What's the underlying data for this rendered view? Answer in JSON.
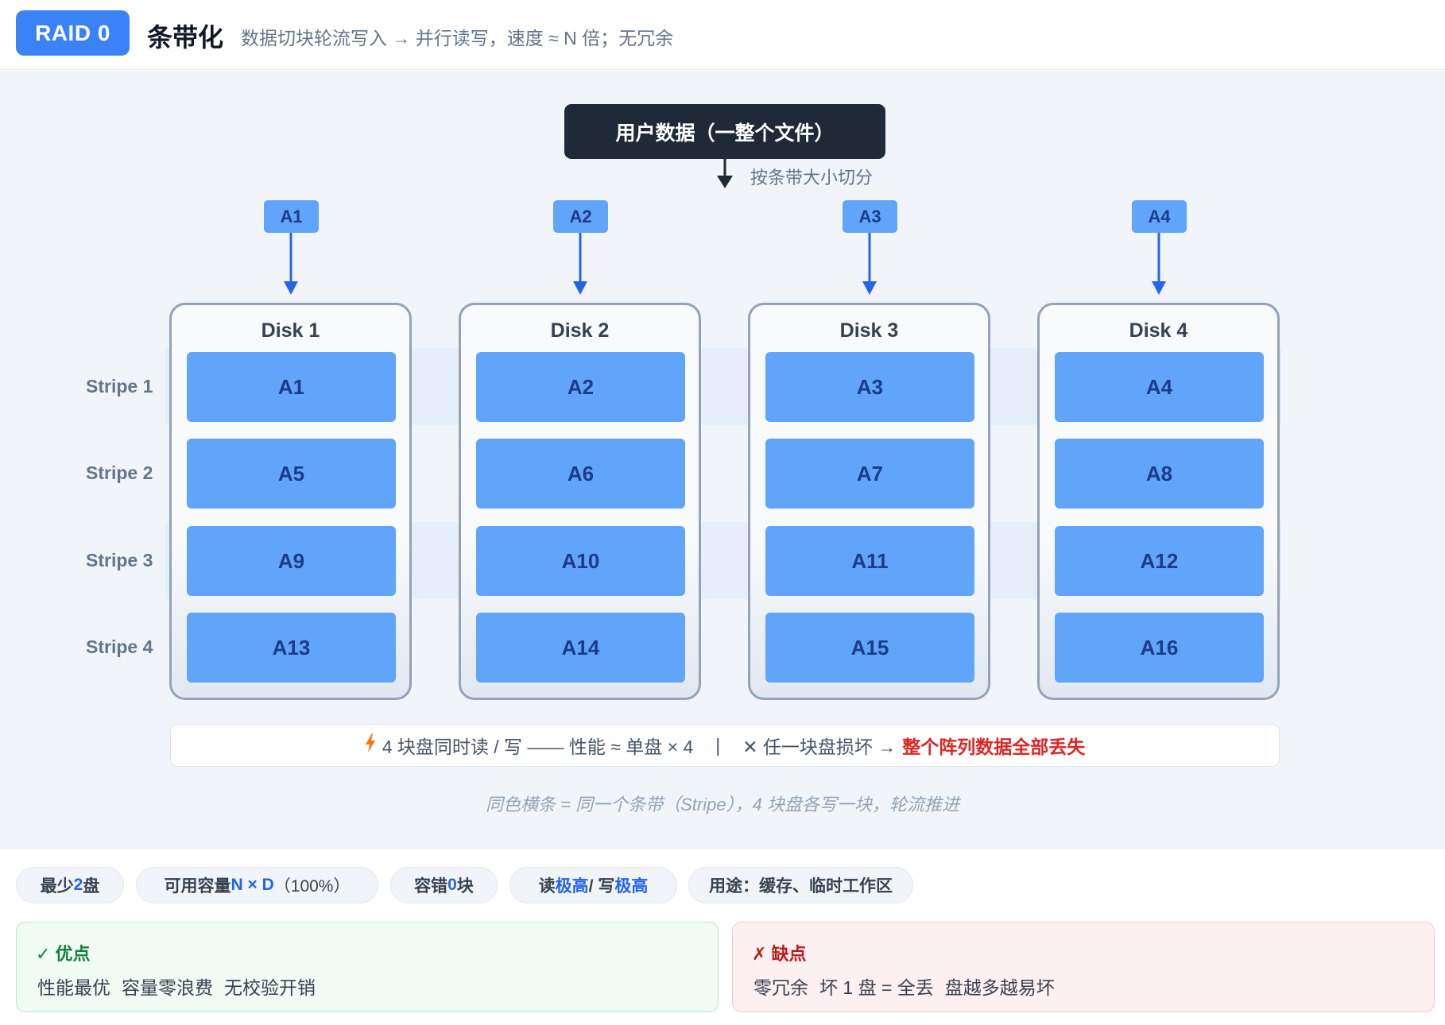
{
  "header": {
    "badge": "RAID 0",
    "title": "条带化",
    "subtitle": "数据切块轮流写入 → 并行读写，速度 ≈ N 倍；无冗余"
  },
  "diagram": {
    "source_label": "用户数据（一整个文件）",
    "split_label": "按条带大小切分",
    "chunks": [
      "A1",
      "A2",
      "A3",
      "A4"
    ],
    "stripes": [
      "Stripe 1",
      "Stripe 2",
      "Stripe 3",
      "Stripe 4"
    ],
    "disks": [
      {
        "name": "Disk 1",
        "blocks": [
          "A1",
          "A5",
          "A9",
          "A13"
        ]
      },
      {
        "name": "Disk 2",
        "blocks": [
          "A2",
          "A6",
          "A10",
          "A14"
        ]
      },
      {
        "name": "Disk 3",
        "blocks": [
          "A3",
          "A7",
          "A11",
          "A15"
        ]
      },
      {
        "name": "Disk 4",
        "blocks": [
          "A4",
          "A8",
          "A12",
          "A16"
        ]
      }
    ],
    "info": {
      "performance": "4 块盘同时读 / 写 —— 性能 ≈ 单盘 × 4",
      "separator": "|",
      "risk_prefix": "✕ 任一块盘损坏 →",
      "risk_highlight": "整个阵列数据全部丢失"
    },
    "caption": "同色横条 = 同一个条带（Stripe），4 块盘各写一块，轮流推进"
  },
  "pills": [
    {
      "pre": "最少 ",
      "hl": "2",
      "post": " 盘"
    },
    {
      "pre": "可用容量 ",
      "hl": "N × D",
      "post": "（100%）"
    },
    {
      "pre": "容错 ",
      "hl": "0",
      "post": " 块"
    },
    {
      "pre": "读 ",
      "hl": "极高",
      "mid": " / 写 ",
      "hl2": "极高"
    },
    {
      "pre": "用途：缓存、临时工作区"
    }
  ],
  "pros": {
    "title": "✓ 优点",
    "items": [
      "性能最优",
      "容量零浪费",
      "无校验开销"
    ]
  },
  "cons": {
    "title": "✗ 缺点",
    "items": [
      "零冗余",
      "坏 1 盘 = 全丢",
      "盘越多越易坏"
    ]
  },
  "colors": {
    "accent": "#3b82f6",
    "block": "#60a5fa",
    "block_text": "#1e3a8a",
    "danger": "#dc2626",
    "dark_box": "#1f2937"
  }
}
